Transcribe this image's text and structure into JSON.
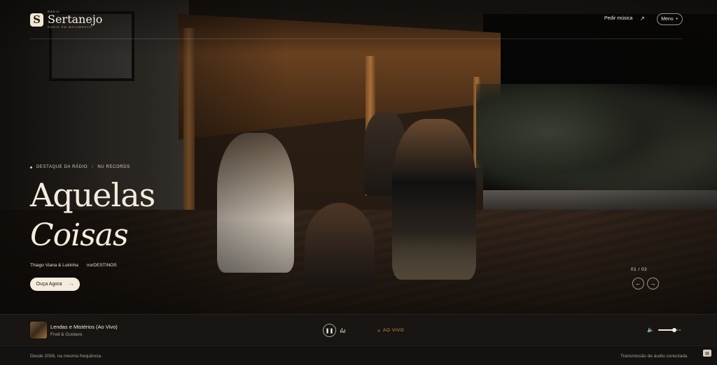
{
  "header": {
    "logo_mark": "S",
    "logo_small": "RÁDIO",
    "logo_name": "Sertanejo",
    "logo_tagline": "RÁDIO EM MOVIMENTO",
    "request_label": "Pedir música",
    "request_icon": "↗",
    "menu_label": "Menu",
    "menu_icon": "+"
  },
  "hero": {
    "eyebrow_primary": "DESTAQUE DA RÁDIO",
    "eyebrow_separator": "/",
    "eyebrow_secondary": "NU RECORDS",
    "title_line1": "Aquelas",
    "title_line2": "Coisas",
    "artists": "Thiago Viana & Lukinha",
    "album": "norDESTINOS",
    "listen_label": "Ouça Agora",
    "listen_icon": "→",
    "slide_counter": "01 / 02",
    "prev_icon": "←",
    "next_icon": "→"
  },
  "player": {
    "track_title": "Lendas e Mistérios (Ao Vivo)",
    "track_artist": "Frod & Gustavo",
    "play_icon": "❚❚",
    "live_label": "AO VIVO",
    "volume_icon": "🔈",
    "volume_level": 0.7
  },
  "footer": {
    "since": "Desde 2006, na mesma frequência.",
    "status": "Transmissão de áudio conectada",
    "chat_icon": "▤"
  },
  "colors": {
    "accent_live": "#d79a3a",
    "cream": "#f4ecdd",
    "background": "#141210"
  }
}
